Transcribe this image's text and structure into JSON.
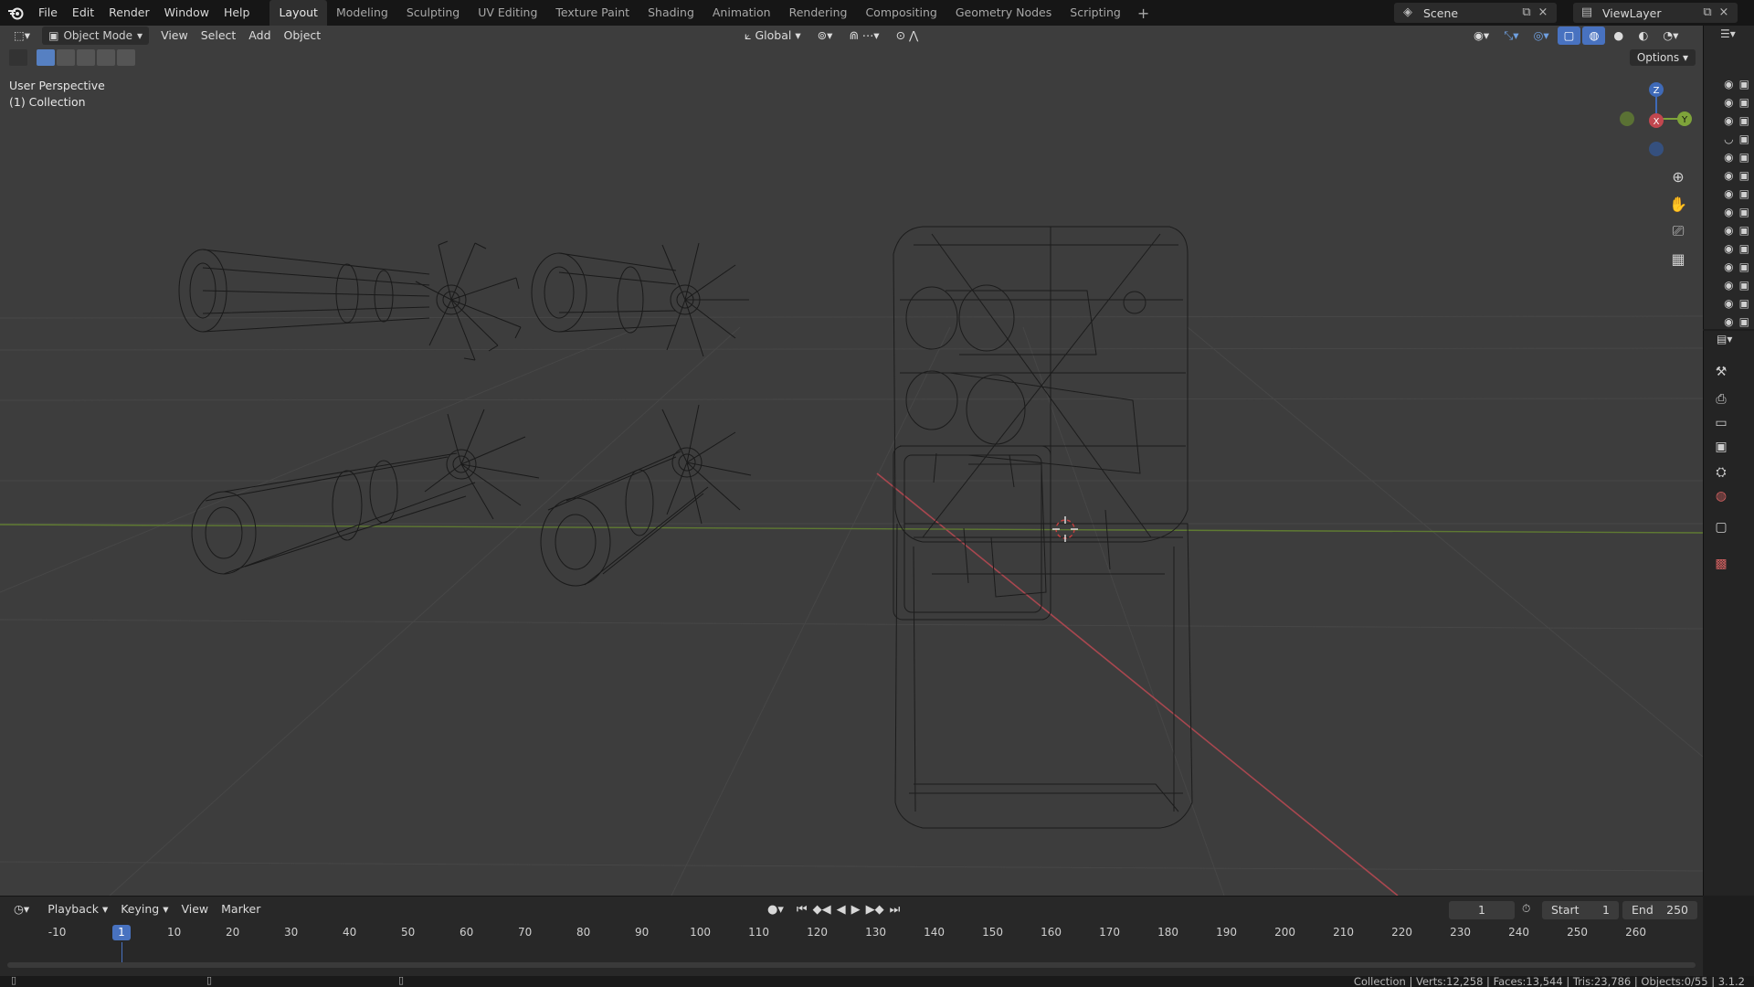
{
  "menu": {
    "items": [
      "File",
      "Edit",
      "Render",
      "Window",
      "Help"
    ]
  },
  "workspaces": {
    "tabs": [
      "Layout",
      "Modeling",
      "Sculpting",
      "UV Editing",
      "Texture Paint",
      "Shading",
      "Animation",
      "Rendering",
      "Compositing",
      "Geometry Nodes",
      "Scripting"
    ],
    "active": "Layout",
    "add_label": "+"
  },
  "scene": {
    "name": "Scene"
  },
  "view_layer": {
    "name": "ViewLayer"
  },
  "viewport": {
    "mode": "Object Mode",
    "menus": [
      "View",
      "Select",
      "Add",
      "Object"
    ],
    "transform_orientation": "Global",
    "view_name": "User Perspective",
    "collection_label": "(1) Collection",
    "options_label": "Options",
    "gizmo": {
      "x": "X",
      "y": "Y",
      "z": "Z"
    }
  },
  "outliner": {
    "row_count": 14
  },
  "timeline": {
    "menus": [
      "Playback",
      "Keying",
      "View",
      "Marker"
    ],
    "current_frame": "1",
    "start_label": "Start",
    "start_value": "1",
    "end_label": "End",
    "end_value": "250",
    "ticks": [
      "-10",
      "10",
      "20",
      "30",
      "40",
      "50",
      "60",
      "70",
      "80",
      "90",
      "100",
      "110",
      "120",
      "130",
      "140",
      "150",
      "160",
      "170",
      "180",
      "190",
      "200",
      "210",
      "220",
      "230",
      "240",
      "250",
      "260"
    ],
    "playhead_label": "1"
  },
  "status": {
    "text": "Collection | Verts:12,258 | Faces:13,544 | Tris:23,786 | Objects:0/55 | 3.1.2"
  },
  "colors": {
    "accent": "#4872c0",
    "axis_x": "#c2474f",
    "axis_y": "#7ea33a",
    "axis_z": "#3f6ab8"
  }
}
